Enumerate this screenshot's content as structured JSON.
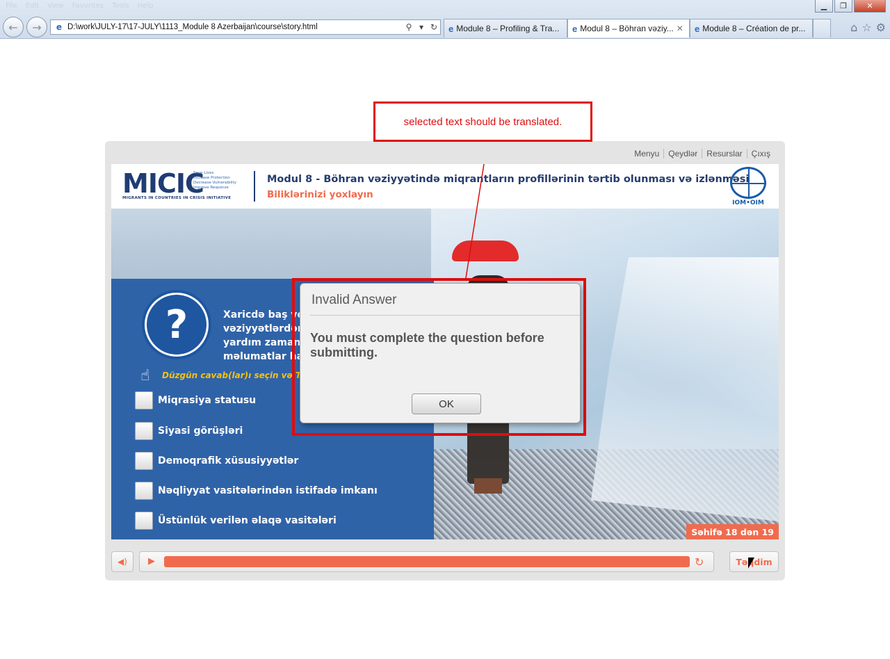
{
  "browser": {
    "menu_ghost": [
      "File",
      "Edit",
      "View",
      "Favorites",
      "Tools",
      "Help"
    ],
    "address_url": "D:\\work\\JULY-17\\17-JULY\\1113_Module 8 Azerbaijan\\course\\story.html",
    "tabs": [
      {
        "label": "Module 8 – Profiling & Tra...",
        "active": false
      },
      {
        "label": "Modul 8 – Böhran vəziy...",
        "active": true
      },
      {
        "label": "Module 8 – Création de pr...",
        "active": false
      }
    ],
    "tab_close": "✕",
    "icons": [
      "back-icon",
      "forward-icon",
      "search-icon",
      "refresh-icon",
      "home-icon",
      "favorites-star-icon",
      "gear-icon"
    ]
  },
  "callout": {
    "text": "selected text should be translated.",
    "color": "#e00d0d"
  },
  "player": {
    "top_links": [
      "Menyu",
      "Qeydlər",
      "Resurslar",
      "Çıxış"
    ],
    "header": {
      "logo_text": "MICIC",
      "logo_tagline": [
        "Save Lives",
        "Increase Protection",
        "Decrease Vulnerability",
        "Improve Response"
      ],
      "logo_subtitle": "MIGRANTS IN COUNTRIES IN CRISIS INITIATIVE",
      "title": "Modul 8 - Böhran vəziyyətində miqrantların profillərinin tərtib olunması və izlənməsi",
      "subtitle": "Biliklərinizi yoxlayın",
      "iom_label": "IOM•OIM"
    },
    "question": {
      "lines": [
        "Xaricdə baş verən fövqəladə",
        "vəziyyətlərdən",
        "yardım zamanı f",
        "məlumatlar ha"
      ],
      "instruction": "Düzgün cavab(lar)ı seçin və Təq",
      "options": [
        "Miqrasiya statusu",
        "Siyasi görüşləri",
        "Demoqrafik xüsusiyyətlər",
        "Nəqliyyat vasitələrindən istifadə imkanı",
        "Üstünlük verilən əlaqə vasitələri"
      ]
    },
    "page_indicator": "Səhifə 18 dən 19",
    "progress_fraction": 1.0,
    "submit_label": "Təqdim",
    "accent_color": "#f06b4e"
  },
  "modal": {
    "title": "Invalid Answer",
    "message": "You must complete the question before submitting.",
    "ok_label": "OK"
  }
}
